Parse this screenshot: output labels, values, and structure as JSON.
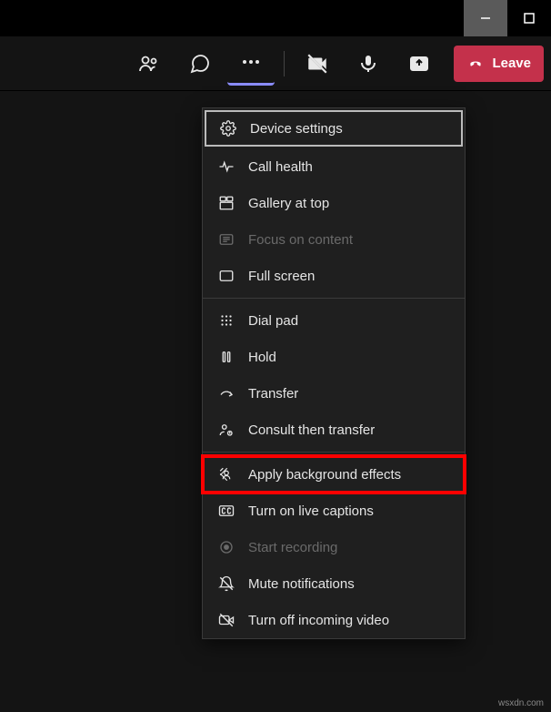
{
  "window": {
    "minimize": "minimize",
    "maximize": "maximize"
  },
  "toolbar": {
    "people": "people",
    "chat": "chat",
    "more": "more-options",
    "camera": "camera-off",
    "mic": "microphone",
    "share": "share-screen",
    "leave_label": "Leave"
  },
  "menu": {
    "items": [
      {
        "label": "Device settings",
        "disabled": false,
        "focused": true,
        "highlighted": false,
        "icon": "gear"
      },
      {
        "label": "Call health",
        "disabled": false,
        "focused": false,
        "highlighted": false,
        "icon": "pulse"
      },
      {
        "label": "Gallery at top",
        "disabled": false,
        "focused": false,
        "highlighted": false,
        "icon": "gallery"
      },
      {
        "label": "Focus on content",
        "disabled": true,
        "focused": false,
        "highlighted": false,
        "icon": "focus"
      },
      {
        "label": "Full screen",
        "disabled": false,
        "focused": false,
        "highlighted": false,
        "icon": "fullscreen"
      }
    ],
    "items2": [
      {
        "label": "Dial pad",
        "disabled": false,
        "focused": false,
        "highlighted": false,
        "icon": "dialpad"
      },
      {
        "label": "Hold",
        "disabled": false,
        "focused": false,
        "highlighted": false,
        "icon": "hold"
      },
      {
        "label": "Transfer",
        "disabled": false,
        "focused": false,
        "highlighted": false,
        "icon": "transfer"
      },
      {
        "label": "Consult then transfer",
        "disabled": false,
        "focused": false,
        "highlighted": false,
        "icon": "consult"
      }
    ],
    "items3": [
      {
        "label": "Apply background effects",
        "disabled": false,
        "focused": false,
        "highlighted": true,
        "icon": "background"
      },
      {
        "label": "Turn on live captions",
        "disabled": false,
        "focused": false,
        "highlighted": false,
        "icon": "cc"
      },
      {
        "label": "Start recording",
        "disabled": true,
        "focused": false,
        "highlighted": false,
        "icon": "record"
      },
      {
        "label": "Mute notifications",
        "disabled": false,
        "focused": false,
        "highlighted": false,
        "icon": "mutebell"
      },
      {
        "label": "Turn off incoming video",
        "disabled": false,
        "focused": false,
        "highlighted": false,
        "icon": "videooff"
      }
    ]
  },
  "watermark": "wsxdn.com"
}
